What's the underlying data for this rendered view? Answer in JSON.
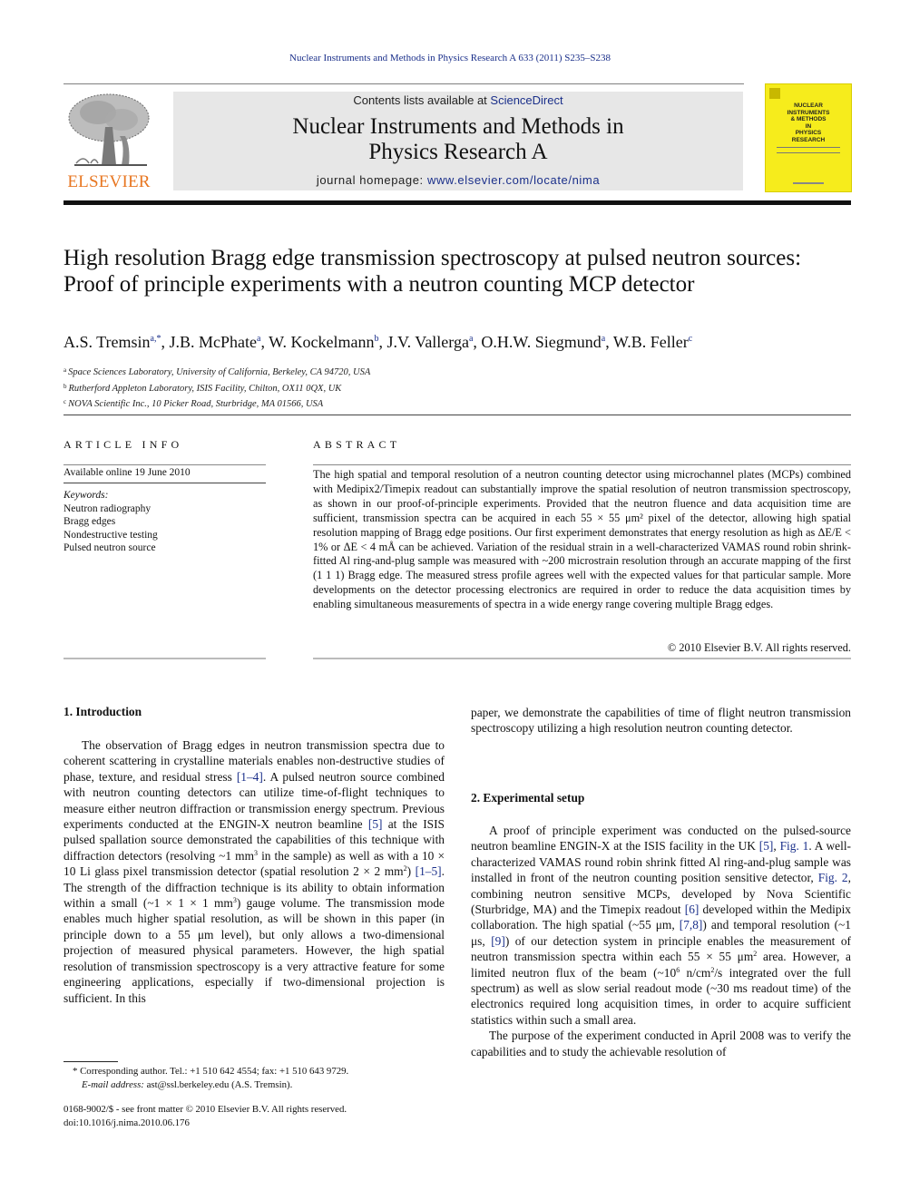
{
  "header": {
    "running_head": "Nuclear Instruments and Methods in Physics Research A 633 (2011) S235–S238",
    "publisher_logo_text": "ELSEVIER",
    "contents_prefix": "Contents lists available at ",
    "contents_link": "ScienceDirect",
    "journal_title_line1": "Nuclear Instruments and Methods in",
    "journal_title_line2": "Physics Research A",
    "homepage_prefix": "journal homepage: ",
    "homepage_link": "www.elsevier.com/locate/nima",
    "cover_title_lines": [
      "NUCLEAR",
      "INSTRUMENTS",
      "& METHODS",
      "IN",
      "PHYSICS",
      "RESEARCH"
    ],
    "colors": {
      "elsevier_orange": "#e87722",
      "link_blue": "#1a2f8a",
      "cover_yellow": "#f6ec1c",
      "masthead_gray": "#e7e7e7"
    }
  },
  "article": {
    "title": "High resolution Bragg edge transmission spectroscopy at pulsed neutron sources: Proof of principle experiments with a neutron counting MCP detector",
    "authors": [
      {
        "name": "A.S. Tremsin",
        "sup": "a,*"
      },
      {
        "name": "J.B. McPhate",
        "sup": "a"
      },
      {
        "name": "W. Kockelmann",
        "sup": "b"
      },
      {
        "name": "J.V. Vallerga",
        "sup": "a"
      },
      {
        "name": "O.H.W. Siegmund",
        "sup": "a"
      },
      {
        "name": "W.B. Feller",
        "sup": "c"
      }
    ],
    "affiliations": [
      {
        "key": "a",
        "text": "Space Sciences Laboratory, University of California, Berkeley, CA 94720, USA"
      },
      {
        "key": "b",
        "text": "Rutherford Appleton Laboratory, ISIS Facility, Chilton, OX11 0QX, UK"
      },
      {
        "key": "c",
        "text": "NOVA Scientific Inc., 10 Picker Road, Sturbridge, MA 01566, USA"
      }
    ]
  },
  "article_info": {
    "heading": "ARTICLE INFO",
    "available_online": "Available online 19 June 2010",
    "keywords_label": "Keywords:",
    "keywords": [
      "Neutron radiography",
      "Bragg edges",
      "Nondestructive testing",
      "Pulsed neutron source"
    ]
  },
  "abstract": {
    "heading": "ABSTRACT",
    "text": "The high spatial and temporal resolution of a neutron counting detector using microchannel plates (MCPs) combined with Medipix2/Timepix readout can substantially improve the spatial resolution of neutron transmission spectroscopy, as shown in our proof-of-principle experiments. Provided that the neutron fluence and data acquisition time are sufficient, transmission spectra can be acquired in each 55 × 55 μm² pixel of the detector, allowing high spatial resolution mapping of Bragg edge positions. Our first experiment demonstrates that energy resolution as high as ΔE/E < 1% or ΔE < 4 mÅ can be achieved. Variation of the residual strain in a well-characterized VAMAS round robin shrink-fitted Al ring-and-plug sample was measured with ~200 microstrain resolution through an accurate mapping of the first (1 1 1) Bragg edge. The measured stress profile agrees well with the expected values for that particular sample. More developments on the detector processing electronics are required in order to reduce the data acquisition times by enabling simultaneous measurements of spectra in a wide energy range covering multiple Bragg edges.",
    "copyright": "© 2010 Elsevier B.V. All rights reserved."
  },
  "sections": {
    "intro": {
      "title": "1.  Introduction",
      "p1_a": "The observation of Bragg edges in neutron transmission spectra due to coherent scattering in crystalline materials enables non-destructive studies of phase, texture, and residual stress ",
      "ref_1": "[1–4]",
      "p1_b": ". A pulsed neutron source combined with neutron counting detectors can utilize time-of-flight techniques to measure either neutron diffraction or transmission energy spectrum. Previous experiments conducted at the ENGIN-X neutron beamline ",
      "ref_2": "[5]",
      "p1_c": " at the ISIS pulsed spallation source demonstrated the capabilities of this technique with diffraction detectors (resolving ~1 mm",
      "p1_sup1": "3",
      "p1_d": " in the sample) as well as with a 10 × 10 Li glass pixel transmission detector (spatial resolution 2 × 2 mm",
      "p1_sup2": "2",
      "p1_e": ") ",
      "ref_3": "[1–5]",
      "p1_f": ". The strength of the diffraction technique is its ability to obtain information within a small (~1 × 1 × 1 mm",
      "p1_sup3": "3",
      "p1_g": ") gauge volume. The transmission mode enables much higher spatial resolution, as will be shown in this paper (in principle down to a 55 μm level), but only allows a two-dimensional projection of measured physical parameters. However, the high spatial resolution of transmission spectroscopy is a very attractive feature for some engineering applications, especially if two-dimensional projection is sufficient. In this",
      "p1_cont": "paper, we demonstrate the capabilities of time of flight neutron transmission spectroscopy utilizing a high resolution neutron counting detector."
    },
    "setup": {
      "title": "2.  Experimental setup",
      "p1_a": "A proof of principle experiment was conducted on the pulsed-source neutron beamline ENGIN-X at the ISIS facility in the UK ",
      "ref_1": "[5]",
      "p1_b": ", ",
      "ref_fig1": "Fig. 1",
      "p1_c": ". A well-characterized VAMAS round robin shrink fitted Al ring-and-plug sample was installed in front of the neutron counting position sensitive detector, ",
      "ref_fig2": "Fig. 2",
      "p1_d": ", combining neutron sensitive MCPs, developed by Nova Scientific (Sturbridge, MA) and the Timepix readout ",
      "ref_2": "[6]",
      "p1_e": " developed within the Medipix collaboration. The high spatial (~55 μm, ",
      "ref_3": "[7,8]",
      "p1_f": ") and temporal resolution (~1 μs, ",
      "ref_4": "[9]",
      "p1_g": ") of our detection system in principle enables the measurement of neutron transmission spectra within each 55 × 55 μm",
      "p1_sup1": "2",
      "p1_h": " area. However, a limited neutron flux of the beam (~10",
      "p1_sup2": "6",
      "p1_i": " n/cm",
      "p1_sup3": "2",
      "p1_j": "/s integrated over the full spectrum) as well as slow serial readout mode (~30 ms readout time) of the electronics required long acquisition times, in order to acquire sufficient statistics within such a small area.",
      "p2": "The purpose of the experiment conducted in April 2008 was to verify the capabilities and to study the achievable resolution of"
    }
  },
  "footnotes": {
    "corresponding": "* Corresponding author. Tel.: +1 510 642 4554; fax: +1 510 643 9729.",
    "email_label": "E-mail address:",
    "email_value": " ast@ssl.berkeley.edu (A.S. Tremsin).",
    "issn_line": "0168-9002/$ - see front matter © 2010 Elsevier B.V. All rights reserved.",
    "doi": "doi:10.1016/j.nima.2010.06.176"
  }
}
